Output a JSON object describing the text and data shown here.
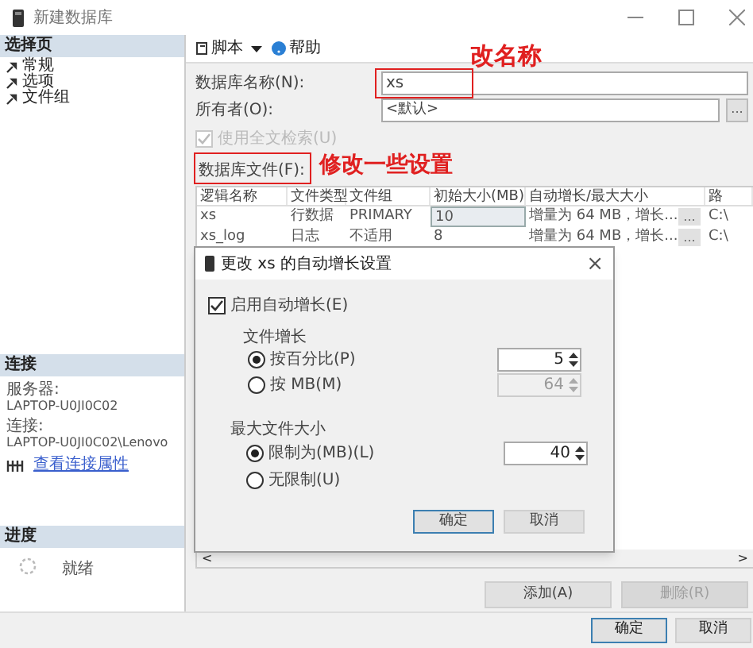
{
  "window": {
    "title": "新建数据库"
  },
  "sidebar": {
    "header": "选择页",
    "items": [
      {
        "label": "常规"
      },
      {
        "label": "选项"
      },
      {
        "label": "文件组"
      }
    ]
  },
  "connection": {
    "header": "连接",
    "server_label": "服务器:",
    "server": "LAPTOP-U0JI0C02",
    "connection_label": "连接:",
    "connection": "LAPTOP-U0JI0C02\\Lenovo",
    "link": "查看连接属性"
  },
  "progress": {
    "header": "进度",
    "status": "就绪"
  },
  "toolbar": [
    {
      "label": "脚本",
      "kind": "script"
    },
    {
      "label": "帮助",
      "kind": "help"
    }
  ],
  "annotations": [
    "改名称",
    "修改一些设置"
  ],
  "name_field": {
    "label": "数据库名称(N):",
    "value": "xs"
  },
  "owner_field": {
    "label": "所有者(O):",
    "value": "<默认>",
    "button": "..."
  },
  "fulltext": {
    "label": "使用全文检索(U)",
    "checked": true,
    "disabled": true
  },
  "files": {
    "label": "数据库文件(F):",
    "columns": [
      "逻辑名称",
      "文件类型",
      "文件组",
      "初始大小(MB)",
      "自动增长/最大大小",
      "路"
    ],
    "rows": [
      {
        "cells": [
          "xs",
          "行数据",
          "PRIMARY",
          "10",
          "增量为 64 MB，增长...",
          "C:\\"
        ],
        "editing": true,
        "button": "..."
      },
      {
        "cells": [
          "xs_log",
          "日志",
          "不适用",
          "8",
          "增量为 64 MB，增长...",
          "C:\\"
        ],
        "editing": false,
        "button": "..."
      }
    ]
  },
  "scrollbar": {
    "left": "<",
    "right": ">"
  },
  "file_buttons": [
    {
      "label": "添加(A)",
      "disabled": false
    },
    {
      "label": "删除(R)",
      "disabled": true
    }
  ],
  "footer_buttons": [
    {
      "label": "确定",
      "default": true
    },
    {
      "label": "取消",
      "default": false
    }
  ],
  "dialog": {
    "title": "更改 xs 的自动增长设置",
    "close": "×",
    "enable": {
      "label": "启用自动增长(E)",
      "checked": true
    },
    "growth": {
      "label": "文件增长",
      "options": [
        {
          "label": "按百分比(P)",
          "selected": true,
          "value": "5"
        },
        {
          "label": "按 MB(M)",
          "selected": false,
          "value": "64"
        }
      ]
    },
    "max": {
      "label": "最大文件大小",
      "options": [
        {
          "label": "限制为(MB)(L)",
          "selected": true,
          "value": "40"
        },
        {
          "label": "无限制(U)",
          "selected": false
        }
      ]
    },
    "buttons": [
      {
        "label": "确定",
        "default": true
      },
      {
        "label": "取消",
        "default": false
      }
    ]
  }
}
